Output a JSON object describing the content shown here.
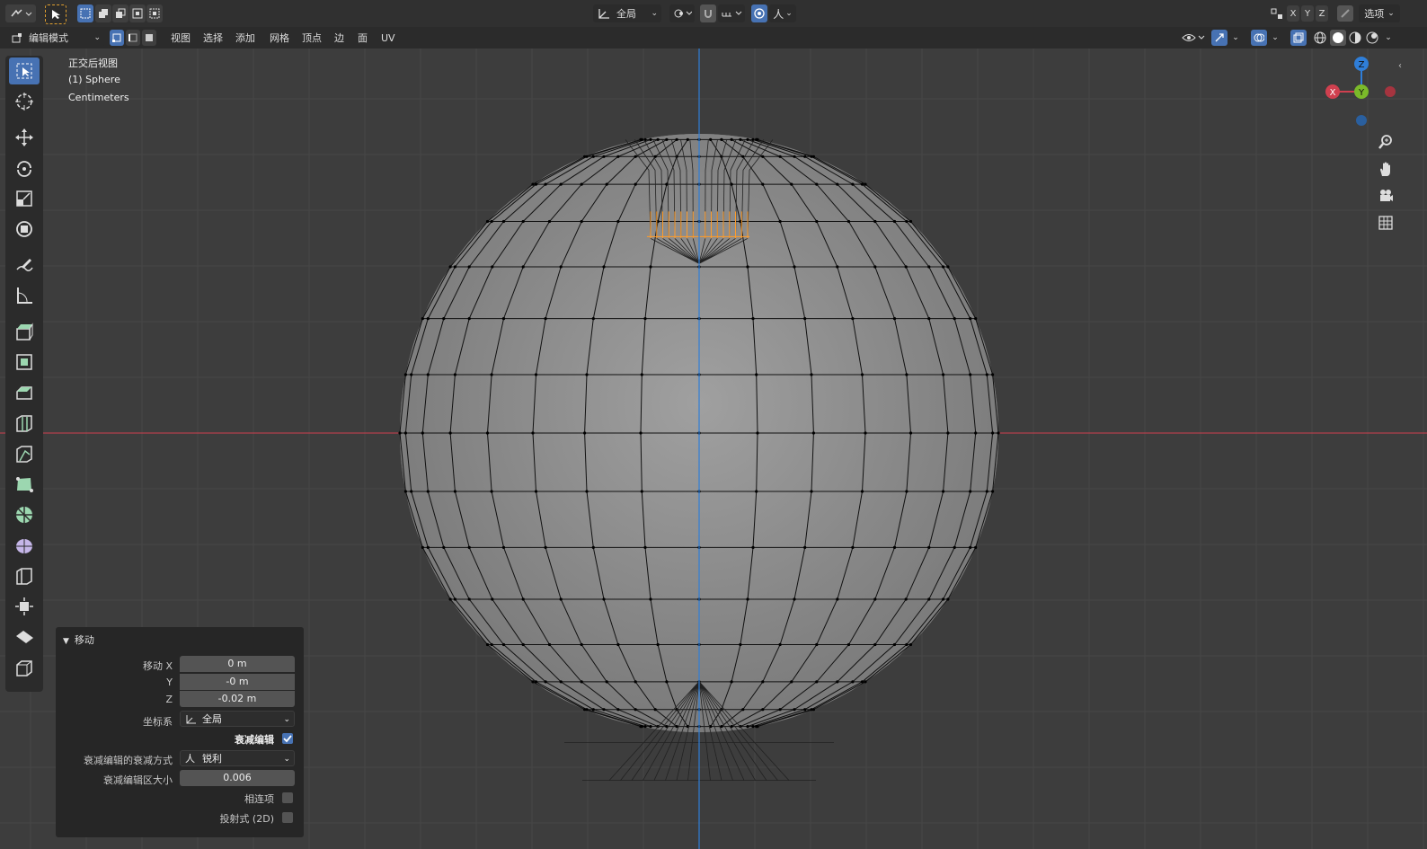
{
  "topbar": {
    "transform_orientation": "全局",
    "axis_labels": [
      "X",
      "Y",
      "Z"
    ],
    "options_label": "选项"
  },
  "header": {
    "mode_label": "编辑模式",
    "menus": [
      "视图",
      "选择",
      "添加",
      "网格",
      "顶点",
      "边",
      "面",
      "UV"
    ]
  },
  "viewport": {
    "view_name": "正交后视图",
    "object_name": "(1) Sphere",
    "units": "Centimeters",
    "gizmo": {
      "x": "X",
      "y": "Y",
      "z": "Z"
    },
    "colors": {
      "x_axis": "#d0404f",
      "y_axis": "#7bba2a",
      "z_axis": "#2f7ed8",
      "selection": "#ff9c29",
      "background": "#3d3d3d"
    }
  },
  "operator_panel": {
    "title": "移动",
    "move_x_label": "移动 X",
    "move_x": "0 m",
    "move_y_label": "Y",
    "move_y": "-0 m",
    "move_z_label": "Z",
    "move_z": "-0.02 m",
    "orientation_label": "坐标系",
    "orientation_value": "全局",
    "proportional_label": "衰减编辑",
    "proportional_checked": true,
    "falloff_label": "衰减编辑的衰减方式",
    "falloff_value": "锐利",
    "size_label": "衰减编辑区大小",
    "size_value": "0.006",
    "connected_label": "相连项",
    "connected_checked": false,
    "projected_label": "投射式 (2D)",
    "projected_checked": false
  }
}
